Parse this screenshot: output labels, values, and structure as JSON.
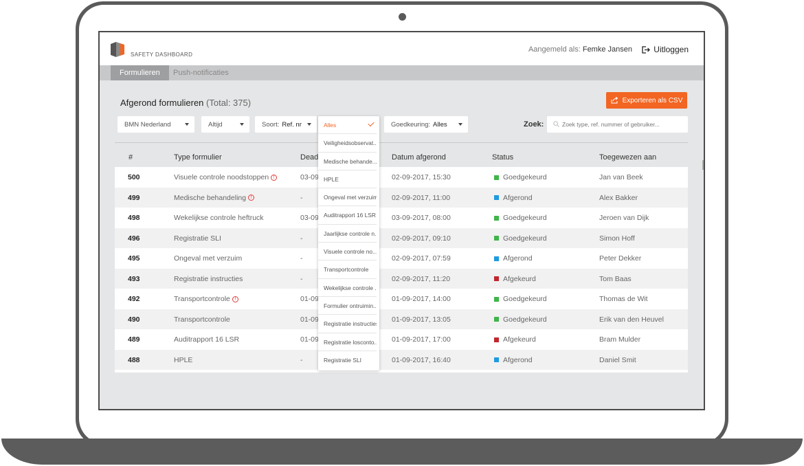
{
  "app": {
    "logo_text": "SAFETY DASHBOARD"
  },
  "header": {
    "login_label": "Aangemeld als:",
    "user_name": "Femke Jansen",
    "logout_label": "Uitloggen"
  },
  "nav": {
    "tabs": [
      {
        "label": "Formulieren",
        "active": true
      },
      {
        "label": "Push-notificaties",
        "active": false
      }
    ]
  },
  "page": {
    "title": "Afgerond formulieren",
    "total": "(Total: 375)",
    "export_label": "Exporteren als CSV"
  },
  "filters": {
    "location": "BMN Nederland",
    "period": "Altijd",
    "sort_label": "Soort:",
    "sort_value": "Ref. nr",
    "approval_label": "Goedkeuring:",
    "approval_value": "Alles",
    "search_label": "Zoek:",
    "search_placeholder": "Zoek type, ref. nummer of gebruiker..."
  },
  "dropdown": {
    "items": [
      "Alles",
      "Veiligheidsobservat...",
      "Medische behande...",
      "HPLE",
      "Ongeval met verzuim",
      "Auditrapport 16 LSR",
      "Jaarlijkse controle n...",
      "Visuele controle no...",
      "Transportcontrole",
      "Wekelijkse controle ...",
      "Formulier ontruimin...",
      "Registratie instructies",
      "Registratie losconto...",
      "Registratie SLI"
    ],
    "selected": "Alles"
  },
  "table": {
    "columns": [
      "#",
      "Type formulier",
      "Deadline",
      "Datum afgerond",
      "Status",
      "Toegewezen aan"
    ],
    "rows": [
      {
        "num": "500",
        "type": "Visuele controle noodstoppen",
        "warn": true,
        "deadline": "03-09",
        "date": "02-09-2017, 15:30",
        "status": "Goedgekeurd",
        "assignee": "Jan van Beek"
      },
      {
        "num": "499",
        "type": "Medische behandeling",
        "warn": true,
        "deadline": "-",
        "date": "02-09-2017, 11:00",
        "status": "Afgerond",
        "assignee": "Alex Bakker"
      },
      {
        "num": "498",
        "type": "Wekelijkse controle heftruck",
        "warn": false,
        "deadline": "03-09",
        "date": "03-09-2017, 08:00",
        "status": "Goedgekeurd",
        "assignee": "Jeroen van Dijk"
      },
      {
        "num": "496",
        "type": "Registratie SLI",
        "warn": false,
        "deadline": "-",
        "date": "02-09-2017, 09:10",
        "status": "Goedgekeurd",
        "assignee": "Simon Hoff"
      },
      {
        "num": "495",
        "type": "Ongeval met verzuim",
        "warn": false,
        "deadline": "-",
        "date": "02-09-2017, 07:59",
        "status": "Afgerond",
        "assignee": "Peter Dekker"
      },
      {
        "num": "493",
        "type": "Registratie instructies",
        "warn": false,
        "deadline": "-",
        "date": "02-09-2017, 11:20",
        "status": "Afgekeurd",
        "assignee": "Tom Baas"
      },
      {
        "num": "492",
        "type": "Transportcontrole",
        "warn": true,
        "deadline": "01-09",
        "date": "01-09-2017, 14:00",
        "status": "Goedgekeurd",
        "assignee": "Thomas de Wit"
      },
      {
        "num": "490",
        "type": "Transportcontrole",
        "warn": false,
        "deadline": "01-09",
        "date": "01-09-2017, 13:05",
        "status": "Goedgekeurd",
        "assignee": "Erik van den Heuvel"
      },
      {
        "num": "489",
        "type": "Auditrapport 16 LSR",
        "warn": false,
        "deadline": "01-09",
        "date": "01-09-2017, 17:00",
        "status": "Afgekeurd",
        "assignee": "Bram Mulder"
      },
      {
        "num": "488",
        "type": "HPLE",
        "warn": false,
        "deadline": "-",
        "date": "01-09-2017, 16:40",
        "status": "Afgerond",
        "assignee": "Daniel Smit"
      }
    ]
  },
  "colors": {
    "accent": "#f26522",
    "status_Goedgekeurd": "#3fb54a",
    "status_Afgerond": "#1e9be0",
    "status_Afgekeurd": "#c1272d"
  },
  "icons": {
    "logout": "logout-icon",
    "export": "share-icon",
    "search": "search-icon",
    "warning": "warning-icon",
    "logo": "logo-icon"
  }
}
